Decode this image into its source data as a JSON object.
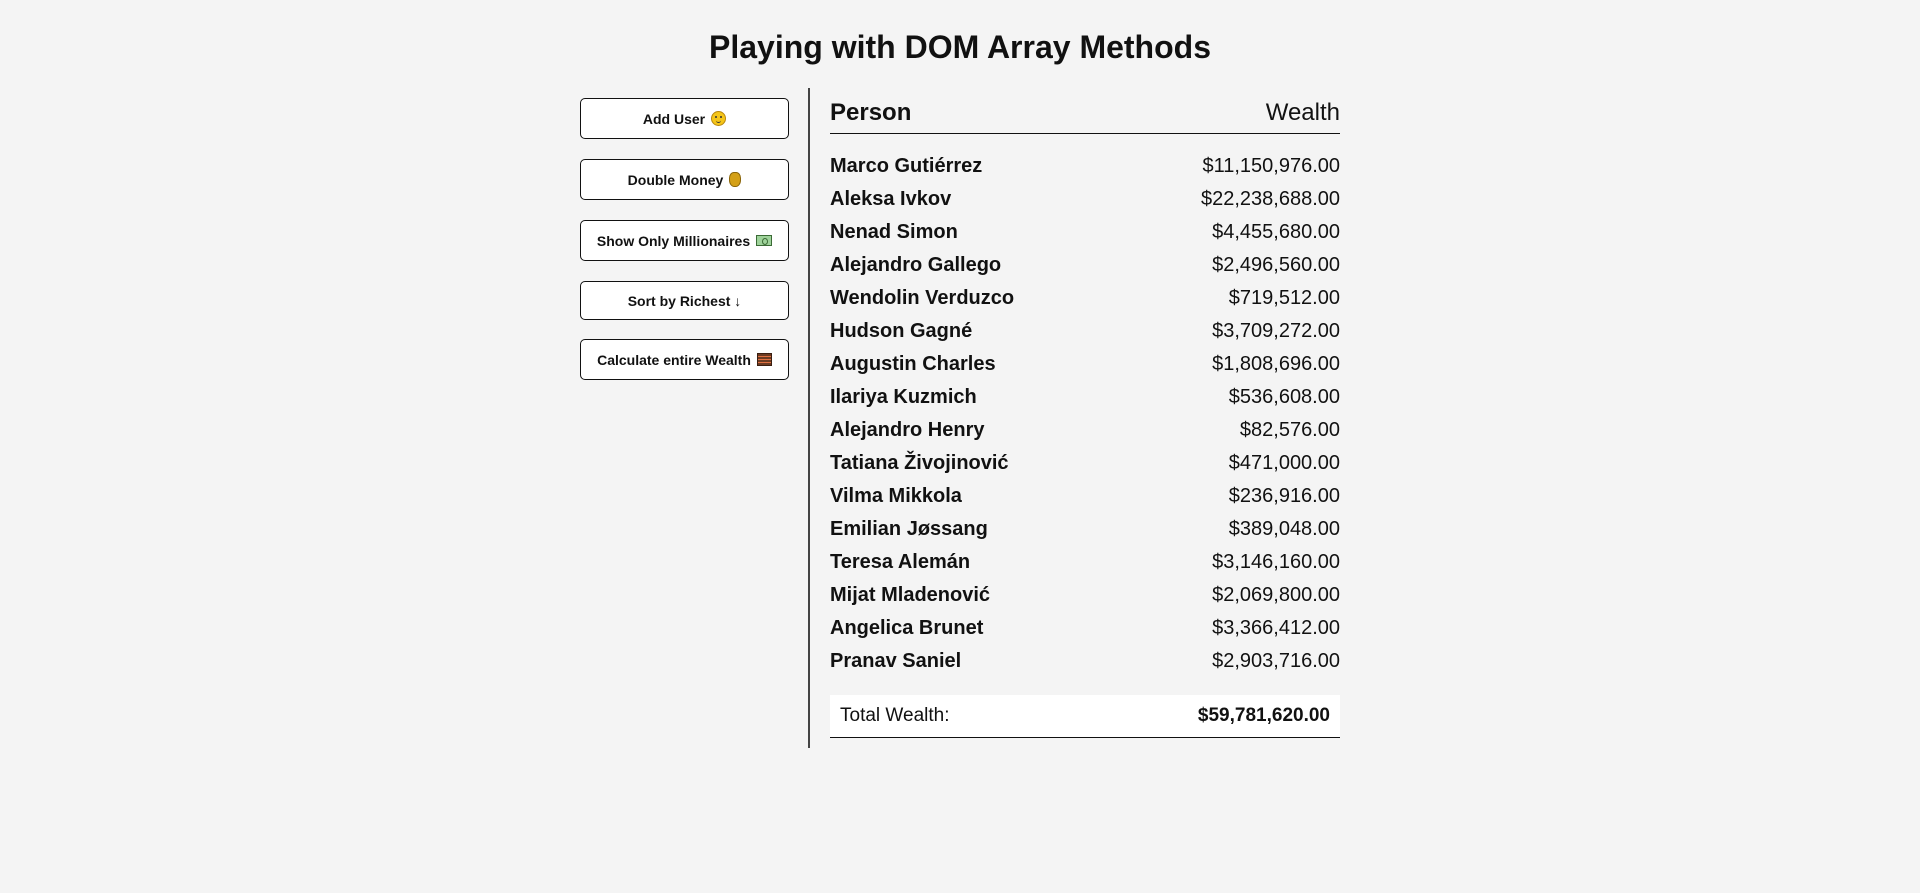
{
  "title": "Playing with DOM Array Methods",
  "buttons": [
    {
      "label": "Add User",
      "icon": "face-icon"
    },
    {
      "label": "Double Money",
      "icon": "money-bag-icon"
    },
    {
      "label": "Show Only Millionaires",
      "icon": "dollar-bill-icon"
    },
    {
      "label": "Sort by Richest ↓",
      "icon": ""
    },
    {
      "label": "Calculate entire Wealth",
      "icon": "abacus-icon"
    }
  ],
  "table": {
    "header_person": "Person",
    "header_wealth": "Wealth",
    "rows": [
      {
        "name": "Marco Gutiérrez",
        "wealth": "$11,150,976.00"
      },
      {
        "name": "Aleksa Ivkov",
        "wealth": "$22,238,688.00"
      },
      {
        "name": "Nenad Simon",
        "wealth": "$4,455,680.00"
      },
      {
        "name": "Alejandro Gallego",
        "wealth": "$2,496,560.00"
      },
      {
        "name": "Wendolin Verduzco",
        "wealth": "$719,512.00"
      },
      {
        "name": "Hudson Gagné",
        "wealth": "$3,709,272.00"
      },
      {
        "name": "Augustin Charles",
        "wealth": "$1,808,696.00"
      },
      {
        "name": "Ilariya Kuzmich",
        "wealth": "$536,608.00"
      },
      {
        "name": "Alejandro Henry",
        "wealth": "$82,576.00"
      },
      {
        "name": "Tatiana Živojinović",
        "wealth": "$471,000.00"
      },
      {
        "name": "Vilma Mikkola",
        "wealth": "$236,916.00"
      },
      {
        "name": "Emilian Jøssang",
        "wealth": "$389,048.00"
      },
      {
        "name": "Teresa Alemán",
        "wealth": "$3,146,160.00"
      },
      {
        "name": "Mijat Mladenović",
        "wealth": "$2,069,800.00"
      },
      {
        "name": "Angelica Brunet",
        "wealth": "$3,366,412.00"
      },
      {
        "name": "Pranav Saniel",
        "wealth": "$2,903,716.00"
      }
    ],
    "total_label": "Total Wealth:",
    "total_value": "$59,781,620.00"
  }
}
